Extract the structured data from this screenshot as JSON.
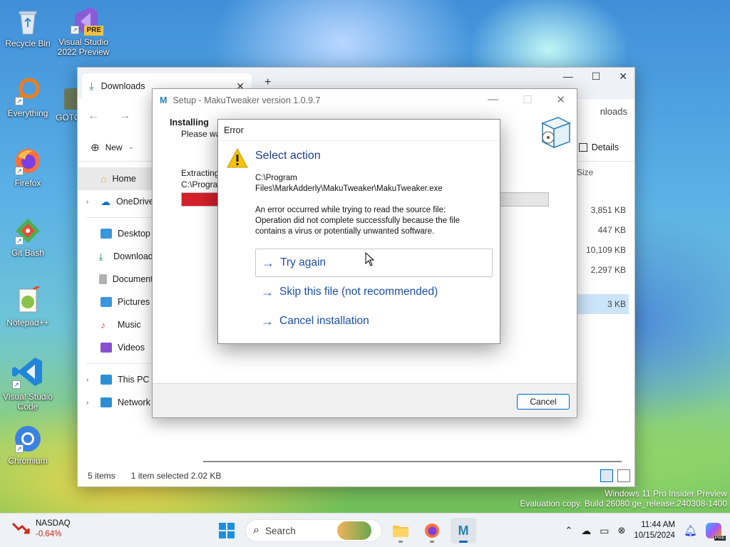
{
  "desktop": {
    "icons": [
      {
        "label": "Recycle Bin"
      },
      {
        "label": "Visual Studio 2022 Preview",
        "badge": "PRE"
      },
      {
        "label": "Everything"
      },
      {
        "label": "GOTO"
      },
      {
        "label": "Firefox"
      },
      {
        "label": "Git Bash"
      },
      {
        "label": "Notepad++"
      },
      {
        "label": "Visual Studio Code"
      },
      {
        "label": "Chromium"
      }
    ],
    "watermark_line1": "Windows 11 Pro Insider Preview",
    "watermark_line2": "Evaluation copy. Build 26080.ge_release.240308-1400"
  },
  "explorer": {
    "tab_title": "Downloads",
    "address_partial": "nloads",
    "new_label": "New",
    "details_label": "Details",
    "sidebar": [
      {
        "label": "Home",
        "icon": "home-icon",
        "color": "#e8a33c"
      },
      {
        "label": "OneDrive",
        "icon": "cloud-icon",
        "color": "#1d6fd1"
      },
      {
        "label": "Desktop",
        "icon": "desktop-folder-icon",
        "color": "#3a96dd"
      },
      {
        "label": "Downloads",
        "icon": "download-icon",
        "color": "#1a8f5a"
      },
      {
        "label": "Documents",
        "icon": "documents-icon",
        "color": "#888888"
      },
      {
        "label": "Pictures",
        "icon": "pictures-icon",
        "color": "#3a96dd"
      },
      {
        "label": "Music",
        "icon": "music-icon",
        "color": "#d9534f"
      },
      {
        "label": "Videos",
        "icon": "videos-icon",
        "color": "#8a4fd1"
      },
      {
        "label": "This PC",
        "icon": "pc-icon",
        "color": "#2b8fd6"
      },
      {
        "label": "Network",
        "icon": "network-icon",
        "color": "#2b8fd6"
      }
    ],
    "size_header": "Size",
    "sizes": [
      "3,851 KB",
      "447 KB",
      "10,109 KB",
      "2,297 KB",
      "3 KB"
    ],
    "status_items": "5 items",
    "status_selected": "1 item selected  2.02 KB"
  },
  "setup": {
    "title": "Setup - MakuTweaker version 1.0.9.7",
    "heading": "Installing",
    "subheading": "Please wait",
    "extracting": "Extracting",
    "path_partial": "C:\\Program",
    "progress_percent": 60,
    "cancel_label": "Cancel"
  },
  "error": {
    "title": "Error",
    "heading": "Select action",
    "path_line1": "C:\\Program",
    "path_line2": "Files\\MarkAdderly\\MakuTweaker\\MakuTweaker.exe",
    "message_line1": "An error occurred while trying to read the source file:",
    "message_line2": "Operation did not complete successfully because the file",
    "message_line3": "contains a virus or potentially unwanted software.",
    "actions": [
      {
        "label": "Try again"
      },
      {
        "label": "Skip this file (not recommended)"
      },
      {
        "label": "Cancel installation"
      }
    ]
  },
  "taskbar": {
    "widget_name": "NASDAQ",
    "widget_change": "-0.64%",
    "search_placeholder": "Search",
    "time": "11:44 AM",
    "date": "10/15/2024",
    "copilot_badge": "PRE"
  },
  "colors": {
    "accent": "#0067c0",
    "link": "#1c4ea8",
    "progress_fill": "#d4202a",
    "negative": "#c42b1c"
  }
}
